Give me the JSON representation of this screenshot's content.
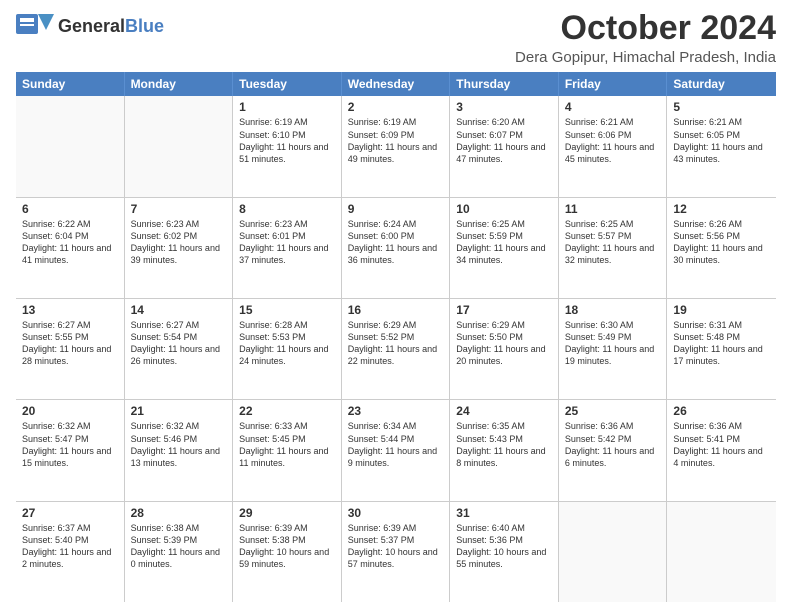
{
  "header": {
    "logo_general": "General",
    "logo_blue": "Blue",
    "month_title": "October 2024",
    "location": "Dera Gopipur, Himachal Pradesh, India"
  },
  "days_of_week": [
    "Sunday",
    "Monday",
    "Tuesday",
    "Wednesday",
    "Thursday",
    "Friday",
    "Saturday"
  ],
  "weeks": [
    {
      "cells": [
        {
          "day": "",
          "info": ""
        },
        {
          "day": "",
          "info": ""
        },
        {
          "day": "1",
          "info": "Sunrise: 6:19 AM\nSunset: 6:10 PM\nDaylight: 11 hours\nand 51 minutes."
        },
        {
          "day": "2",
          "info": "Sunrise: 6:19 AM\nSunset: 6:09 PM\nDaylight: 11 hours\nand 49 minutes."
        },
        {
          "day": "3",
          "info": "Sunrise: 6:20 AM\nSunset: 6:07 PM\nDaylight: 11 hours\nand 47 minutes."
        },
        {
          "day": "4",
          "info": "Sunrise: 6:21 AM\nSunset: 6:06 PM\nDaylight: 11 hours\nand 45 minutes."
        },
        {
          "day": "5",
          "info": "Sunrise: 6:21 AM\nSunset: 6:05 PM\nDaylight: 11 hours\nand 43 minutes."
        }
      ]
    },
    {
      "cells": [
        {
          "day": "6",
          "info": "Sunrise: 6:22 AM\nSunset: 6:04 PM\nDaylight: 11 hours\nand 41 minutes."
        },
        {
          "day": "7",
          "info": "Sunrise: 6:23 AM\nSunset: 6:02 PM\nDaylight: 11 hours\nand 39 minutes."
        },
        {
          "day": "8",
          "info": "Sunrise: 6:23 AM\nSunset: 6:01 PM\nDaylight: 11 hours\nand 37 minutes."
        },
        {
          "day": "9",
          "info": "Sunrise: 6:24 AM\nSunset: 6:00 PM\nDaylight: 11 hours\nand 36 minutes."
        },
        {
          "day": "10",
          "info": "Sunrise: 6:25 AM\nSunset: 5:59 PM\nDaylight: 11 hours\nand 34 minutes."
        },
        {
          "day": "11",
          "info": "Sunrise: 6:25 AM\nSunset: 5:57 PM\nDaylight: 11 hours\nand 32 minutes."
        },
        {
          "day": "12",
          "info": "Sunrise: 6:26 AM\nSunset: 5:56 PM\nDaylight: 11 hours\nand 30 minutes."
        }
      ]
    },
    {
      "cells": [
        {
          "day": "13",
          "info": "Sunrise: 6:27 AM\nSunset: 5:55 PM\nDaylight: 11 hours\nand 28 minutes."
        },
        {
          "day": "14",
          "info": "Sunrise: 6:27 AM\nSunset: 5:54 PM\nDaylight: 11 hours\nand 26 minutes."
        },
        {
          "day": "15",
          "info": "Sunrise: 6:28 AM\nSunset: 5:53 PM\nDaylight: 11 hours\nand 24 minutes."
        },
        {
          "day": "16",
          "info": "Sunrise: 6:29 AM\nSunset: 5:52 PM\nDaylight: 11 hours\nand 22 minutes."
        },
        {
          "day": "17",
          "info": "Sunrise: 6:29 AM\nSunset: 5:50 PM\nDaylight: 11 hours\nand 20 minutes."
        },
        {
          "day": "18",
          "info": "Sunrise: 6:30 AM\nSunset: 5:49 PM\nDaylight: 11 hours\nand 19 minutes."
        },
        {
          "day": "19",
          "info": "Sunrise: 6:31 AM\nSunset: 5:48 PM\nDaylight: 11 hours\nand 17 minutes."
        }
      ]
    },
    {
      "cells": [
        {
          "day": "20",
          "info": "Sunrise: 6:32 AM\nSunset: 5:47 PM\nDaylight: 11 hours\nand 15 minutes."
        },
        {
          "day": "21",
          "info": "Sunrise: 6:32 AM\nSunset: 5:46 PM\nDaylight: 11 hours\nand 13 minutes."
        },
        {
          "day": "22",
          "info": "Sunrise: 6:33 AM\nSunset: 5:45 PM\nDaylight: 11 hours\nand 11 minutes."
        },
        {
          "day": "23",
          "info": "Sunrise: 6:34 AM\nSunset: 5:44 PM\nDaylight: 11 hours\nand 9 minutes."
        },
        {
          "day": "24",
          "info": "Sunrise: 6:35 AM\nSunset: 5:43 PM\nDaylight: 11 hours\nand 8 minutes."
        },
        {
          "day": "25",
          "info": "Sunrise: 6:36 AM\nSunset: 5:42 PM\nDaylight: 11 hours\nand 6 minutes."
        },
        {
          "day": "26",
          "info": "Sunrise: 6:36 AM\nSunset: 5:41 PM\nDaylight: 11 hours\nand 4 minutes."
        }
      ]
    },
    {
      "cells": [
        {
          "day": "27",
          "info": "Sunrise: 6:37 AM\nSunset: 5:40 PM\nDaylight: 11 hours\nand 2 minutes."
        },
        {
          "day": "28",
          "info": "Sunrise: 6:38 AM\nSunset: 5:39 PM\nDaylight: 11 hours\nand 0 minutes."
        },
        {
          "day": "29",
          "info": "Sunrise: 6:39 AM\nSunset: 5:38 PM\nDaylight: 10 hours\nand 59 minutes."
        },
        {
          "day": "30",
          "info": "Sunrise: 6:39 AM\nSunset: 5:37 PM\nDaylight: 10 hours\nand 57 minutes."
        },
        {
          "day": "31",
          "info": "Sunrise: 6:40 AM\nSunset: 5:36 PM\nDaylight: 10 hours\nand 55 minutes."
        },
        {
          "day": "",
          "info": ""
        },
        {
          "day": "",
          "info": ""
        }
      ]
    }
  ]
}
